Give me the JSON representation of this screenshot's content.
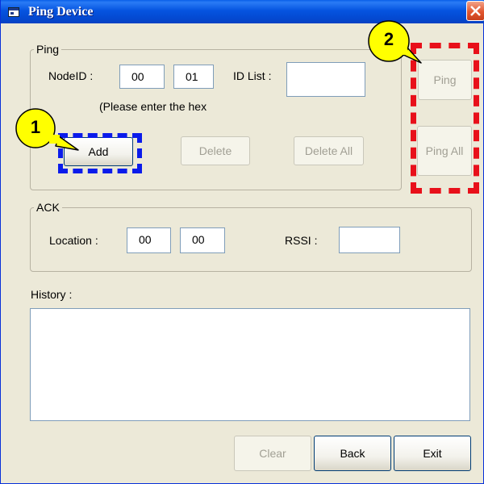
{
  "window": {
    "title": "Ping Device"
  },
  "ping_group": {
    "legend": "Ping",
    "nodeid_label": "NodeID :",
    "nodeid_high": "00",
    "nodeid_low": "01",
    "idlist_label": "ID List :",
    "idlist_value": "",
    "hint": "(Please enter the hex",
    "add_label": "Add",
    "delete_label": "Delete",
    "delete_all_label": "Delete All"
  },
  "side_buttons": {
    "ping_label": "Ping",
    "ping_all_label": "Ping All"
  },
  "ack_group": {
    "legend": "ACK",
    "location_label": "Location :",
    "location_a": "00",
    "location_b": "00",
    "rssi_label": "RSSI :",
    "rssi_value": ""
  },
  "history": {
    "label": "History :",
    "content": ""
  },
  "footer": {
    "clear_label": "Clear",
    "back_label": "Back",
    "exit_label": "Exit"
  },
  "callouts": {
    "one": {
      "number": "1",
      "color": "#0A1BEB"
    },
    "two": {
      "number": "2",
      "color": "#E8101A"
    }
  },
  "colors": {
    "title_bar": "#0554E0",
    "dialog_bg": "#ECE9D8",
    "callout_fill": "#FFFF00"
  }
}
